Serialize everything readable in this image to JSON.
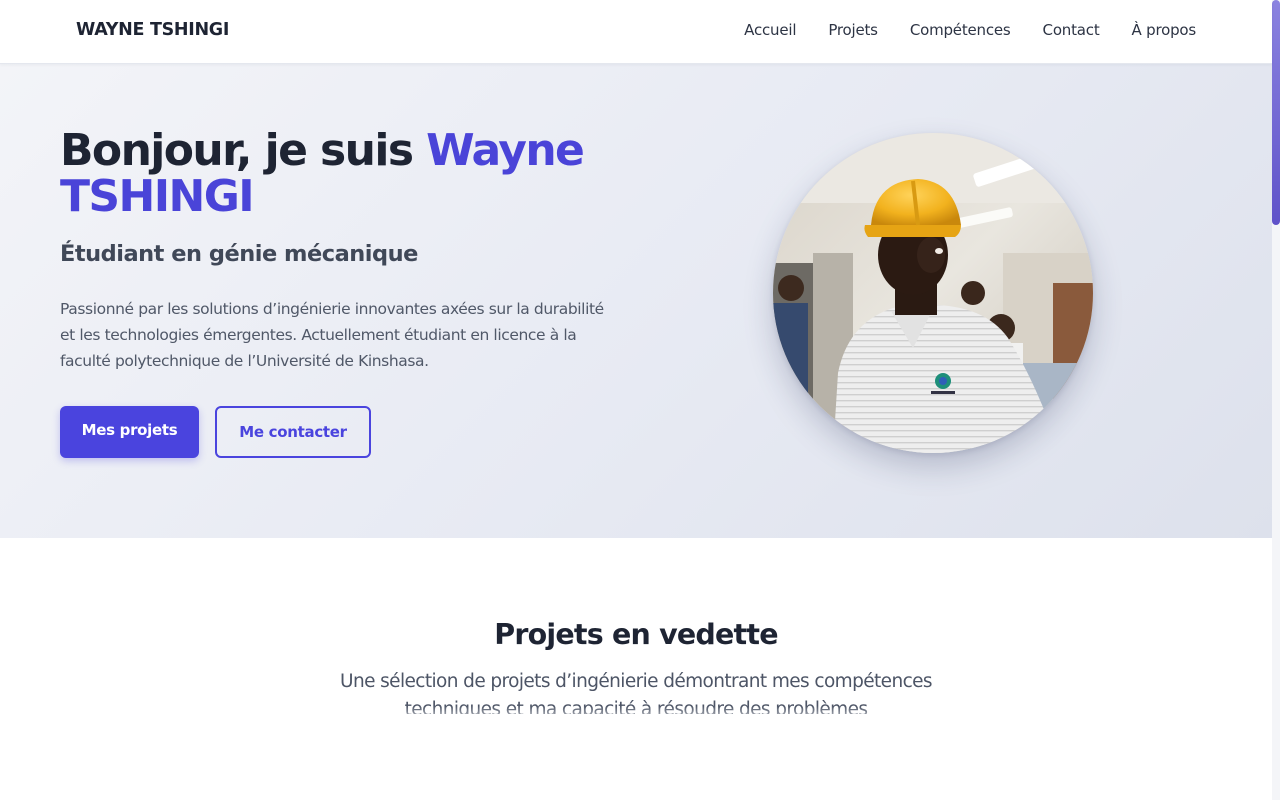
{
  "nav": {
    "brand": "WAYNE TSHINGI",
    "links": [
      "Accueil",
      "Projets",
      "Compétences",
      "Contact",
      "À propos"
    ]
  },
  "hero": {
    "title_prefix": "Bonjour, je suis ",
    "title_name": "Wayne TSHINGI",
    "subtitle": "Étudiant en génie mécanique",
    "description": "Passionné par les solutions d’ingénierie innovantes axées sur la durabilité et les technologies émergentes. Actuellement étudiant en licence à la faculté polytechnique de l’Université de Kinshasa.",
    "primary_button": "Mes projets",
    "secondary_button": "Me contacter",
    "portrait_icon": "portrait-photo-icon"
  },
  "projects": {
    "title": "Projets en vedette",
    "subtitle": "Une sélection de projets d’ingénierie démontrant mes compétences techniques et ma capacité à résoudre des problèmes"
  },
  "colors": {
    "accent": "#4a44de",
    "text_dark": "#1e2433",
    "scrollbar": "#6f63d6"
  }
}
